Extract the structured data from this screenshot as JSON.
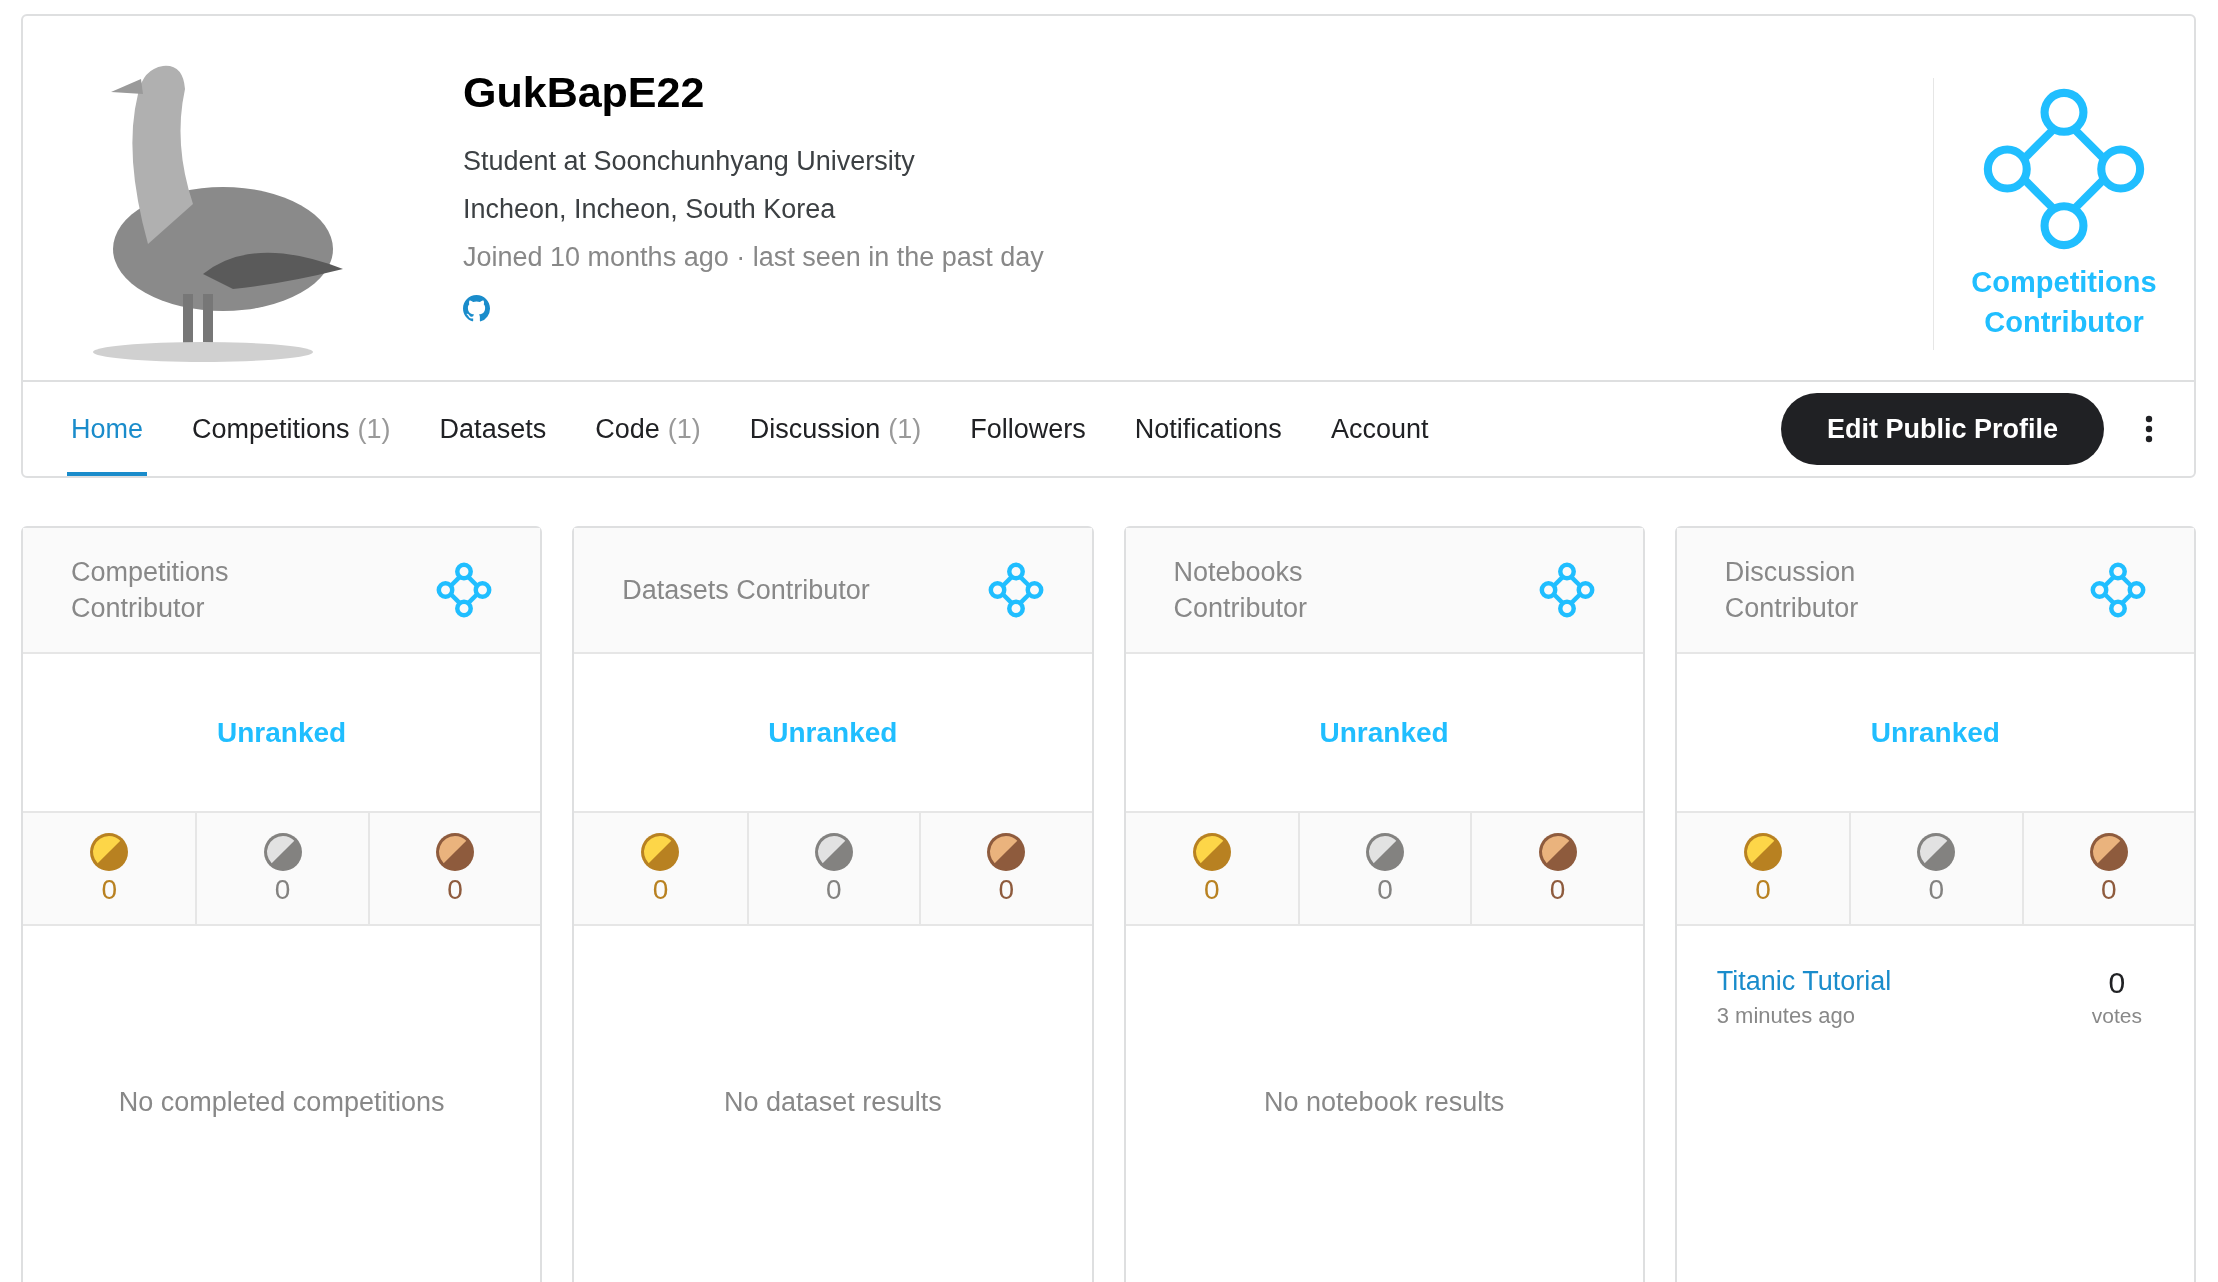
{
  "profile": {
    "name": "GukBapE22",
    "occupation": "Student at Soonchunhyang University",
    "location": "Incheon, Incheon, South Korea",
    "joined": "Joined 10 months ago · last seen in the past day",
    "tier": "Competitions Contributor"
  },
  "tabs": [
    {
      "label": "Home",
      "selected": true
    },
    {
      "label": "Competitions",
      "count": "(1)",
      "selected": false
    },
    {
      "label": "Datasets",
      "selected": false
    },
    {
      "label": "Code",
      "count": "(1)",
      "selected": false
    },
    {
      "label": "Discussion",
      "count": "(1)",
      "selected": false
    },
    {
      "label": "Followers",
      "selected": false
    },
    {
      "label": "Notifications",
      "selected": false
    },
    {
      "label": "Account",
      "selected": false
    }
  ],
  "edit_button": "Edit Public Profile",
  "cards": [
    {
      "title": "Competitions Contributor",
      "rank": "Unranked",
      "medals": [
        {
          "kind": "gold",
          "count": "0"
        },
        {
          "kind": "silver",
          "count": "0"
        },
        {
          "kind": "bronze",
          "count": "0"
        }
      ],
      "empty_message": "No completed competitions"
    },
    {
      "title": "Datasets Contributor",
      "rank": "Unranked",
      "medals": [
        {
          "kind": "gold",
          "count": "0"
        },
        {
          "kind": "silver",
          "count": "0"
        },
        {
          "kind": "bronze",
          "count": "0"
        }
      ],
      "empty_message": "No dataset results"
    },
    {
      "title": "Notebooks Contributor",
      "rank": "Unranked",
      "medals": [
        {
          "kind": "gold",
          "count": "0"
        },
        {
          "kind": "silver",
          "count": "0"
        },
        {
          "kind": "bronze",
          "count": "0"
        }
      ],
      "empty_message": "No notebook results"
    },
    {
      "title": "Discussion Contributor",
      "rank": "Unranked",
      "medals": [
        {
          "kind": "gold",
          "count": "0"
        },
        {
          "kind": "silver",
          "count": "0"
        },
        {
          "kind": "bronze",
          "count": "0"
        }
      ],
      "items": [
        {
          "title": "Titanic Tutorial",
          "time": "3 minutes ago",
          "votes": "0",
          "votes_label": "votes"
        }
      ]
    }
  ]
}
